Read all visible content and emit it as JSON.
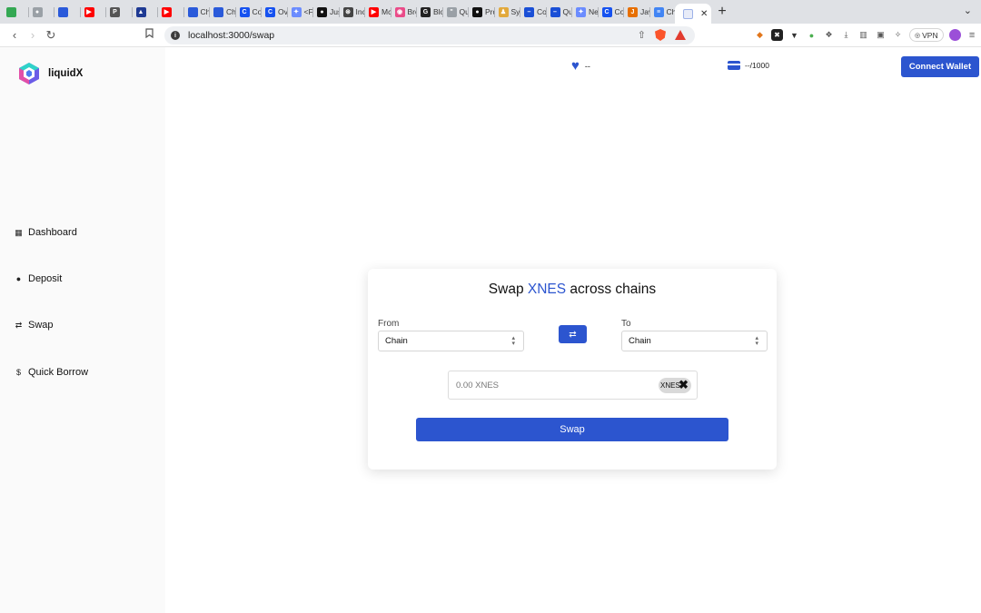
{
  "browser": {
    "tabs": [
      {
        "label": "",
        "icon": "green-square-icon",
        "color": "#34a853",
        "glyph": ""
      },
      {
        "label": "",
        "icon": "github-icon",
        "color": "#9aa0a6",
        "glyph": "●"
      },
      {
        "label": "",
        "icon": "chainlink-icon",
        "color": "#2a5ada",
        "glyph": ""
      },
      {
        "label": "",
        "icon": "youtube-icon",
        "color": "#ff0000",
        "glyph": "▶"
      },
      {
        "label": "",
        "icon": "pdf-icon",
        "color": "#555555",
        "glyph": "P"
      },
      {
        "label": "",
        "icon": "triangle-icon",
        "color": "#1f3a93",
        "glyph": "▲"
      },
      {
        "label": "",
        "icon": "youtube-icon",
        "color": "#ff0000",
        "glyph": "▶"
      },
      {
        "label": "Ch",
        "icon": "chainlink-icon",
        "color": "#2a5ada",
        "glyph": ""
      },
      {
        "label": "Ch",
        "icon": "chainlink-icon",
        "color": "#2a5ada",
        "glyph": ""
      },
      {
        "label": "Co",
        "icon": "coinbase-icon",
        "color": "#1652f0",
        "glyph": "C"
      },
      {
        "label": "Ov",
        "icon": "coinbase-icon",
        "color": "#1652f0",
        "glyph": "C"
      },
      {
        "label": "<F",
        "icon": "gemini-icon",
        "color": "#6b8cff",
        "glyph": "✦"
      },
      {
        "label": "Jus",
        "icon": "dot-icon",
        "color": "#111111",
        "glyph": "●"
      },
      {
        "label": "Inc",
        "icon": "openai-icon",
        "color": "#444444",
        "glyph": "⊛"
      },
      {
        "label": "Mc",
        "icon": "youtube-icon",
        "color": "#ff0000",
        "glyph": "▶"
      },
      {
        "label": "Bro",
        "icon": "dribbble-icon",
        "color": "#ea4c89",
        "glyph": "◉"
      },
      {
        "label": "Blo",
        "icon": "gitbook-icon",
        "color": "#222222",
        "glyph": "G"
      },
      {
        "label": "Qu",
        "icon": "quote-icon",
        "color": "#9aa0a6",
        "glyph": "\""
      },
      {
        "label": "Pro",
        "icon": "github-icon",
        "color": "#111111",
        "glyph": "●"
      },
      {
        "label": "Syl",
        "icon": "person-icon",
        "color": "#e2a93b",
        "glyph": "♟"
      },
      {
        "label": "Co",
        "icon": "minus-circle-icon",
        "color": "#1a4fd6",
        "glyph": "–"
      },
      {
        "label": "Qu",
        "icon": "minus-circle-icon",
        "color": "#1a4fd6",
        "glyph": "–"
      },
      {
        "label": "Ne",
        "icon": "gemini-icon",
        "color": "#6b8cff",
        "glyph": "✦"
      },
      {
        "label": "Co",
        "icon": "coinbase-icon",
        "color": "#1652f0",
        "glyph": "C"
      },
      {
        "label": "Jav",
        "icon": "java-icon",
        "color": "#e76f00",
        "glyph": "J"
      },
      {
        "label": "Ch",
        "icon": "docs-icon",
        "color": "#4285f4",
        "glyph": "≡"
      }
    ],
    "active_tab": {
      "label": "",
      "icon": "app-icon",
      "close": "✕"
    },
    "new_tab": "+",
    "tab_menu": "⌄",
    "url": "localhost:3000/swap",
    "vpn_label": "VPN"
  },
  "app": {
    "brand": "liquidX",
    "nav": [
      {
        "label": "Dashboard",
        "icon": "dashboard-icon",
        "glyph": "▦"
      },
      {
        "label": "Deposit",
        "icon": "bomb-icon",
        "glyph": "●"
      },
      {
        "label": "Swap",
        "icon": "swap-arrows-icon",
        "glyph": "⇄"
      },
      {
        "label": "Quick Borrow",
        "icon": "money-bag-icon",
        "glyph": "$"
      }
    ],
    "lives_value": "--",
    "credits_value": "--/1000",
    "connect_label": "Connect Wallet",
    "accent_color": "#2c55cf"
  },
  "swap": {
    "title_prefix": "Swap ",
    "title_token": "XNES",
    "title_suffix": " across chains",
    "from_label": "From",
    "to_label": "To",
    "from_chain": "Chain",
    "to_chain": "Chain",
    "amount_placeholder": "0.00 XNES",
    "token_symbol": "XNES",
    "button_label": "Swap"
  }
}
